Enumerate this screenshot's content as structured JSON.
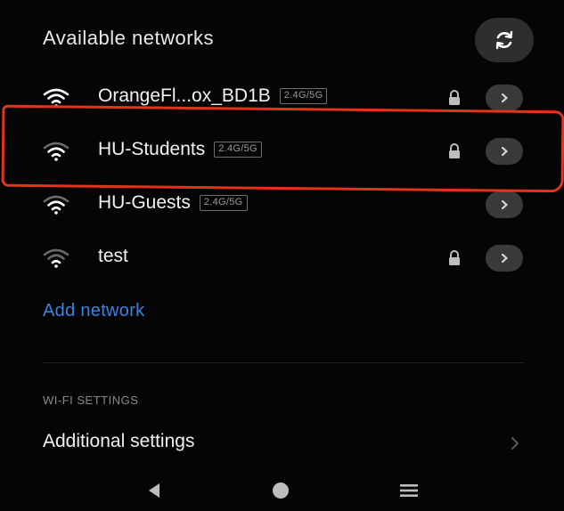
{
  "header": {
    "title": "Available networks",
    "refresh_icon": "refresh-icon"
  },
  "networks": [
    {
      "name": "OrangeFl...ox_BD1B",
      "band": "2.4G/5G",
      "secured": true,
      "signal_icon": "wifi-icon"
    },
    {
      "name": "HU-Students",
      "band": "2.4G/5G",
      "secured": true,
      "signal_icon": "wifi-icon"
    },
    {
      "name": "HU-Guests",
      "band": "2.4G/5G",
      "secured": false,
      "signal_icon": "wifi-icon"
    },
    {
      "name": "test",
      "band": "",
      "secured": true,
      "signal_icon": "wifi-icon"
    }
  ],
  "add_network": {
    "label": "Add network"
  },
  "wifi_settings": {
    "section_header": "WI-FI SETTINGS",
    "additional_settings_label": "Additional settings"
  },
  "navbar": {
    "back_icon": "back-triangle-icon",
    "home_icon": "home-circle-icon",
    "menu_icon": "menu-lines-icon"
  },
  "colors": {
    "background": "#050505",
    "accent_blue": "#3b82e0",
    "highlight_red": "#e1351c",
    "button_gray": "#3a3a3a"
  }
}
